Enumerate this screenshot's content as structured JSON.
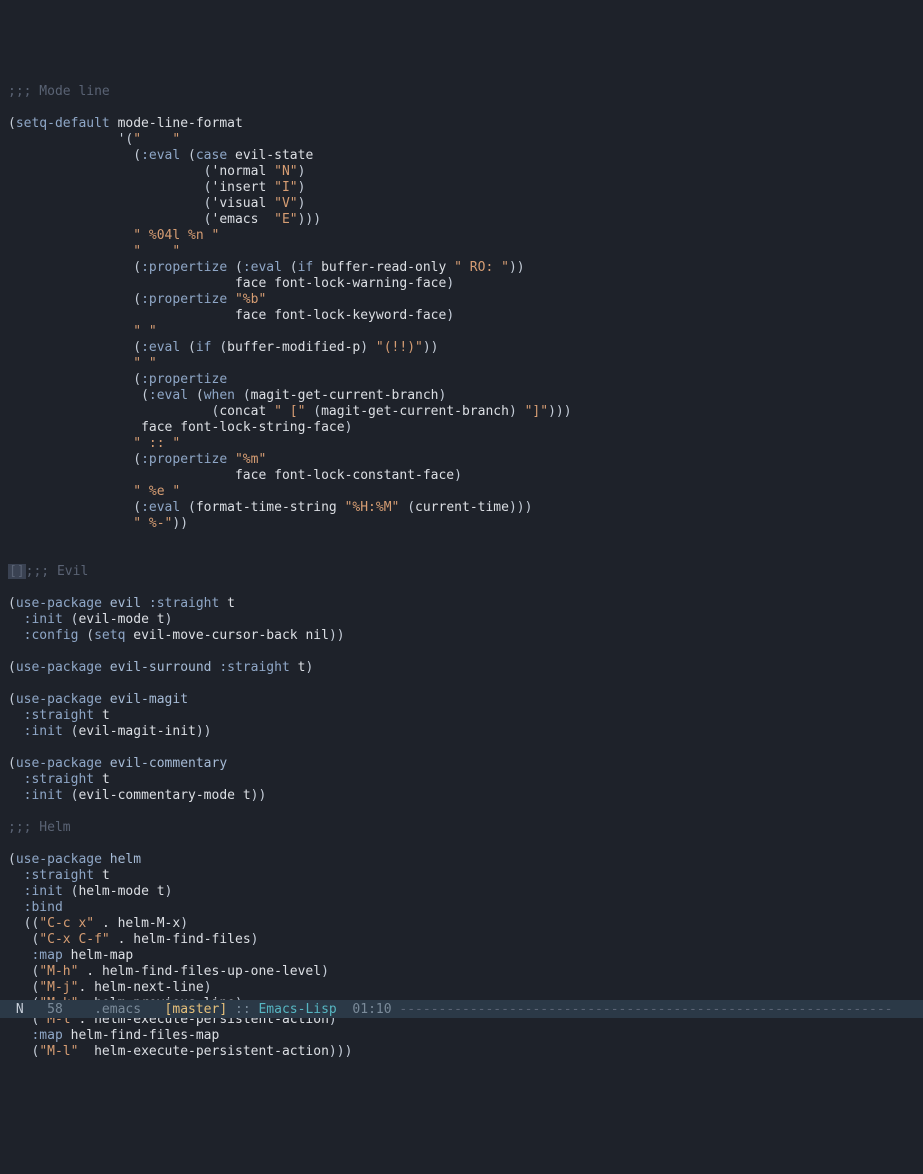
{
  "code": {
    "c_modeline": ";;; Mode line",
    "setq_default": "setq-default",
    "mode_line_format": "mode-line-format",
    "quote_open": "'(",
    "str_sp4": "\"    \"",
    "eval": ":eval",
    "case": "case",
    "evil_state": "evil-state",
    "normal": "'normal",
    "str_N": "\"N\"",
    "insert": "'insert",
    "str_I": "\"I\"",
    "visual": "'visual",
    "str_V": "\"V\"",
    "emacs": "'emacs",
    "str_E": "\"E\"",
    "str_04l": "\" %04l %n \"",
    "str_sp4b": "\"    \"",
    "propertize": ":propertize",
    "if": "if",
    "buffer_read_only": "buffer-read-only",
    "str_RO": "\" RO: \"",
    "face": "face",
    "flw": "font-lock-warning-face",
    "str_pb": "\"%b\"",
    "flk": "font-lock-keyword-face",
    "str_sp": "\" \"",
    "buffer_modified_p": "buffer-modified-p",
    "str_bang": "\"(!!)\"",
    "str_sp2": "\" \"",
    "when": "when",
    "magit_get_current_branch": "magit-get-current-branch",
    "concat": "concat",
    "str_lb": "\" [\"",
    "str_rb": "\"]\"",
    "fls": "font-lock-string-face",
    "str_cc": "\" :: \"",
    "str_pm": "\"%m\"",
    "flc": "font-lock-constant-face",
    "str_pe": "\" %e \"",
    "format_time_string": "format-time-string",
    "str_HM": "\"%H:%M\"",
    "current_time": "current-time",
    "str_pdash": "\" %-\"",
    "c_evil": ";;; Evil",
    "use_package": "use-package",
    "evil": "evil",
    "straight": ":straight",
    "t": "t",
    "init": ":init",
    "evil_mode": "evil-mode",
    "config": ":config",
    "setq": "setq",
    "evil_move_cursor_back": "evil-move-cursor-back",
    "nil": "nil",
    "evil_surround": "evil-surround",
    "evil_magit": "evil-magit",
    "evil_magit_init": "evil-magit-init",
    "evil_commentary": "evil-commentary",
    "evil_commentary_mode": "evil-commentary-mode",
    "c_helm": ";;; Helm",
    "helm": "helm",
    "helm_mode": "helm-mode",
    "bind": ":bind",
    "str_Ccx": "\"C-c x\"",
    "helm_M_x": "helm-M-x",
    "str_CxCf": "\"C-x C-f\"",
    "helm_find_files": "helm-find-files",
    "map": ":map",
    "helm_map": "helm-map",
    "str_Mh": "\"M-h\"",
    "helm_ff_up": "helm-find-files-up-one-level",
    "str_Mj": "\"M-j\"",
    "helm_next_line": "helm-next-line",
    "str_Mk": "\"M-k\"",
    "helm_prev_line": "helm-previous-line",
    "str_Ml": "\"M-l\"",
    "helm_exec_persist": "helm-execute-persistent-action",
    "helm_ff_map": "helm-find-files-map",
    "sel": "[]"
  },
  "modeline": {
    "state": " N ",
    "line": "  58",
    "file": "    .emacs   ",
    "branch": "[master]",
    "sep": " :: ",
    "mode": "Emacs-Lisp",
    "time": "  01:10 ",
    "dash": "---------------------------------------------------------------"
  }
}
